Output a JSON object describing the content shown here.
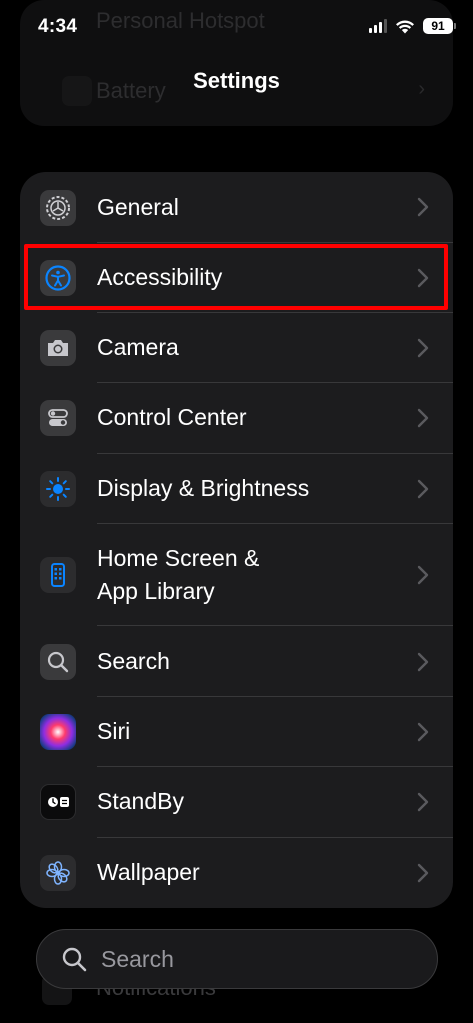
{
  "status_bar": {
    "time": "4:34",
    "battery": "91"
  },
  "background_items": [
    "Personal Hotspot",
    "Battery",
    "Notifications"
  ],
  "nav": {
    "title": "Settings"
  },
  "settings_items": [
    {
      "label": "General",
      "icon": "gear-icon"
    },
    {
      "label": "Accessibility",
      "icon": "accessibility-icon",
      "highlighted": true
    },
    {
      "label": "Camera",
      "icon": "camera-icon"
    },
    {
      "label": "Control Center",
      "icon": "toggles-icon"
    },
    {
      "label": "Display & Brightness",
      "icon": "sun-icon"
    },
    {
      "label": "Home Screen &",
      "label2": "App Library",
      "icon": "phone-grid-icon"
    },
    {
      "label": "Search",
      "icon": "search-icon"
    },
    {
      "label": "Siri",
      "icon": "siri-icon"
    },
    {
      "label": "StandBy",
      "icon": "standby-icon"
    },
    {
      "label": "Wallpaper",
      "icon": "flower-icon"
    }
  ],
  "search": {
    "placeholder": "Search"
  },
  "colors": {
    "highlight": "#ff0000",
    "accessibility_blue": "#0a84ff",
    "card_bg": "#1c1c1e"
  }
}
